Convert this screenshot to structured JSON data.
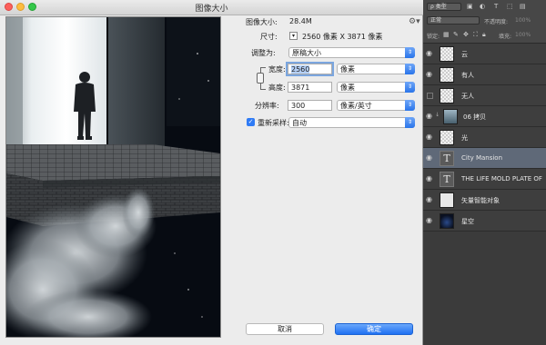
{
  "dialog": {
    "title": "图像大小",
    "image_size_label": "图像大小:",
    "image_size_value": "28.4M",
    "dimensions_label": "尺寸:",
    "dimensions_value": "2560 像素  X  3871 像素",
    "resize_to_label": "调整为:",
    "resize_to_value": "原稿大小",
    "width_label": "宽度:",
    "width_value": "2560",
    "width_unit": "像素",
    "height_label": "高度:",
    "height_value": "3871",
    "height_unit": "像素",
    "resolution_label": "分辨率:",
    "resolution_value": "300",
    "resolution_unit": "像素/英寸",
    "resample_label": "重新采样:",
    "resample_checked": true,
    "resample_value": "自动",
    "cancel_label": "取消",
    "ok_label": "确定"
  },
  "panel": {
    "filter_label": "ρ 类型",
    "blend_mode": "正常",
    "opacity_label": "不透明度:",
    "opacity_value": "100%",
    "lock_label": "锁定:",
    "fill_label": "填充:",
    "fill_value": "100%",
    "layers": [
      {
        "name": "云",
        "thumb": "checker",
        "visible": true,
        "active": false
      },
      {
        "name": "有人",
        "thumb": "checker",
        "visible": true,
        "active": false
      },
      {
        "name": "无人",
        "thumb": "checker",
        "visible": false,
        "active": false
      },
      {
        "name": "06 拷贝",
        "thumb": "copy",
        "visible": true,
        "active": false
      },
      {
        "name": "光",
        "thumb": "checker",
        "visible": true,
        "active": false
      },
      {
        "name": "City Mansion",
        "thumb": "text",
        "visible": true,
        "active": true
      },
      {
        "name": "THE LIFE MOLD PLATE OF ...",
        "thumb": "text",
        "visible": true,
        "active": false
      },
      {
        "name": "矢量智能对象",
        "thumb": "smart",
        "visible": true,
        "active": false
      },
      {
        "name": "星空",
        "thumb": "sky",
        "visible": true,
        "active": false
      }
    ]
  },
  "colors": {
    "accent_blue": "#2f7bf5",
    "active_layer": "#5f6978"
  }
}
